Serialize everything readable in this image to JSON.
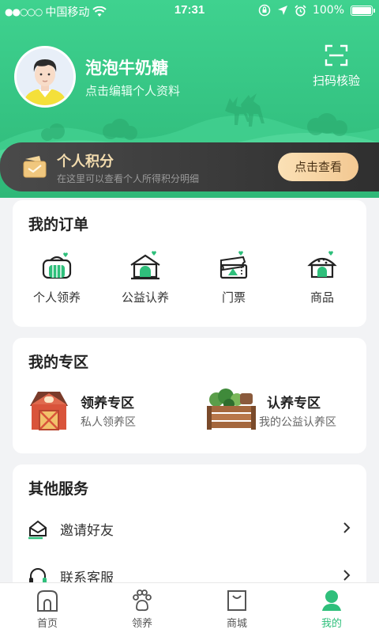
{
  "status_bar": {
    "signal": "●●○○○",
    "carrier": "中国移动",
    "time": "17:31",
    "battery": "100%"
  },
  "profile": {
    "name": "泡泡牛奶糖",
    "edit_link": "点击编辑个人资料",
    "scan_label": "扫码核验"
  },
  "points": {
    "title": "个人积分",
    "subtitle": "在这里可以查看个人所得积分明细",
    "button": "点击查看"
  },
  "orders": {
    "title": "我的订单",
    "items": [
      {
        "label": "个人领养",
        "icon": "pet-carrier-icon"
      },
      {
        "label": "公益认养",
        "icon": "kennel-icon"
      },
      {
        "label": "门票",
        "icon": "ticket-icon"
      },
      {
        "label": "商品",
        "icon": "product-house-icon"
      }
    ]
  },
  "zone": {
    "title": "我的专区",
    "items": [
      {
        "title": "领养专区",
        "subtitle": "私人领养区",
        "icon": "barn-icon"
      },
      {
        "title": "认养专区",
        "subtitle": "我的公益认养区",
        "icon": "crate-icon"
      }
    ]
  },
  "services": {
    "title": "其他服务",
    "items": [
      {
        "label": "邀请好友",
        "icon": "invite-envelope-icon"
      },
      {
        "label": "联系客服",
        "icon": "headset-icon"
      }
    ]
  },
  "tabbar": {
    "tabs": [
      {
        "label": "首页",
        "icon": "home-icon"
      },
      {
        "label": "领养",
        "icon": "paw-icon"
      },
      {
        "label": "商城",
        "icon": "shopping-bag-icon"
      },
      {
        "label": "我的",
        "icon": "user-icon",
        "active": true
      }
    ]
  },
  "colors": {
    "brand_green": "#35c483",
    "points_bg": "#3a3a3a",
    "points_gold": "#f3dcae"
  }
}
